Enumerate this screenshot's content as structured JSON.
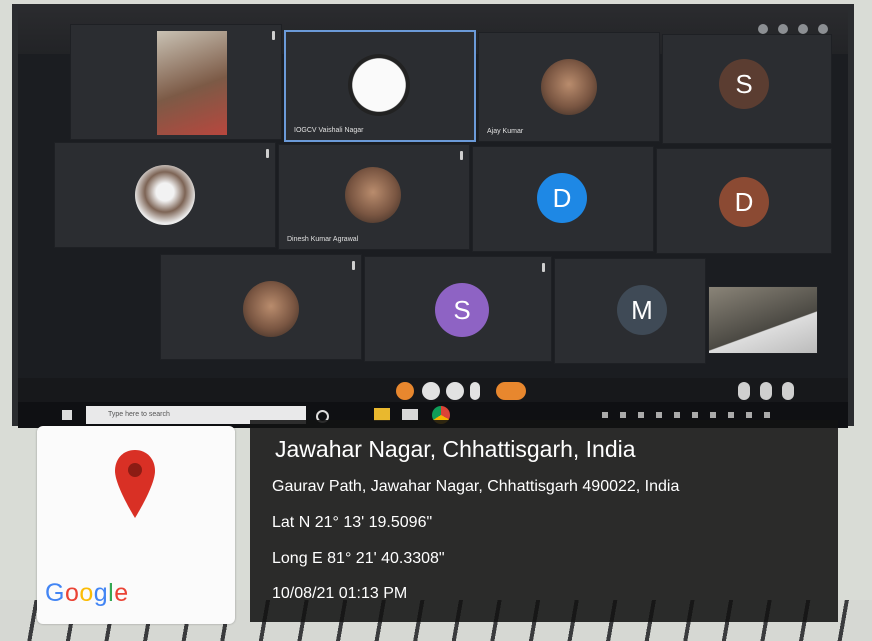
{
  "meeting": {
    "participants": [
      {
        "name": "",
        "kind": "video"
      },
      {
        "name": "IOGCV Vaishali Nagar",
        "kind": "avatar-img",
        "active": true
      },
      {
        "name": "Ajay Kumar",
        "kind": "video"
      },
      {
        "name": "",
        "kind": "letter",
        "letter": "S",
        "color": "#5b3d31"
      },
      {
        "name": "",
        "kind": "video"
      },
      {
        "name": "Dinesh Kumar Agrawal",
        "kind": "video"
      },
      {
        "name": "",
        "kind": "letter",
        "letter": "D",
        "color": "#1e88e5"
      },
      {
        "name": "",
        "kind": "letter",
        "letter": "D",
        "color": "#8b4a33"
      },
      {
        "name": "",
        "kind": "video"
      },
      {
        "name": "",
        "kind": "letter",
        "letter": "S",
        "color": "#8e63c4"
      },
      {
        "name": "",
        "kind": "letter",
        "letter": "M",
        "color": "#3f4a56"
      },
      {
        "name": "",
        "kind": "video"
      }
    ]
  },
  "taskbar": {
    "search_placeholder": "Type here to search"
  },
  "geotag": {
    "title": "Jawahar Nagar, Chhattisgarh, India",
    "address": "Gaurav Path, Jawahar Nagar, Chhattisgarh 490022, India",
    "latitude": "Lat N 21° 13' 19.5096\"",
    "longitude": "Long E 81° 21' 40.3308\"",
    "datetime": "10/08/21 01:13 PM",
    "map_brand": "Google",
    "pin_color": "#d93025"
  }
}
